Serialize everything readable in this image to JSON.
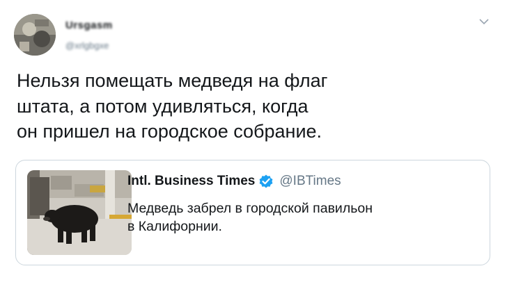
{
  "author": {
    "name": "Ursgasm",
    "handle": "@xrlgbgxe"
  },
  "menu": {
    "icon": "chevron-down-icon"
  },
  "tweet": {
    "text": "Нельзя помещать медведя на флаг\nштата, а потом удивляться, когда\nон пришел на городское собрание."
  },
  "quote": {
    "author_name": "Intl. Business Times",
    "verified_icon": "verified-badge-icon",
    "author_handle": "@IBTimes",
    "text": "Медведь забрел в городской павильон\nв Калифорнии.",
    "thumbnail": "bear-photo"
  },
  "colors": {
    "text": "#14171a",
    "secondary": "#657786",
    "verified": "#1da1f2",
    "border": "#ccd6dd"
  }
}
